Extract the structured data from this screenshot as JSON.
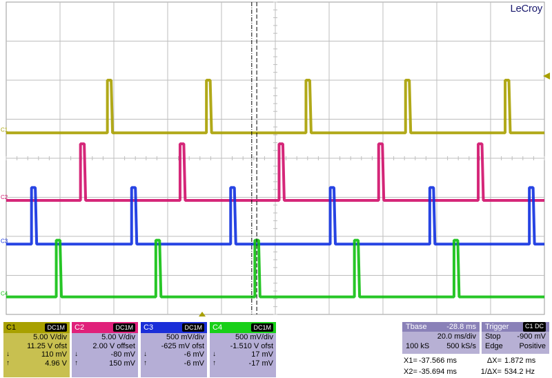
{
  "brand": "LeCroy",
  "chart_data": {
    "type": "line",
    "title": "",
    "xlabel": "",
    "ylabel": "",
    "time_per_div_ms": 20.0,
    "grid": true,
    "divisions": {
      "x": 10,
      "y": 8
    },
    "series": [
      {
        "name": "C1",
        "color": "#a8a000",
        "baseline_div": 3.35,
        "pulse_height_div": 1.35,
        "pulse_starts_div": [
          1.88,
          3.72,
          5.57,
          7.42,
          9.27
        ],
        "pulse_width_div": 0.07
      },
      {
        "name": "C2",
        "color": "#d0106a",
        "baseline_div": 5.08,
        "pulse_height_div": 1.45,
        "pulse_starts_div": [
          1.38,
          3.23,
          5.07,
          6.92,
          8.77
        ],
        "pulse_width_div": 0.07
      },
      {
        "name": "C3",
        "color": "#1030e0",
        "baseline_div": 6.2,
        "pulse_height_div": 1.45,
        "pulse_starts_div": [
          0.47,
          2.33,
          4.17,
          6.02,
          7.87,
          9.72
        ],
        "pulse_width_div": 0.07
      },
      {
        "name": "C4",
        "color": "#10c010",
        "baseline_div": 7.55,
        "pulse_height_div": 1.45,
        "pulse_starts_div": [
          0.93,
          2.78,
          4.62,
          6.47,
          8.32
        ],
        "pulse_width_div": 0.07
      }
    ],
    "cursors": {
      "x1_ms": -37.566,
      "x2_ms": -35.694
    }
  },
  "channels": [
    {
      "name": "C1",
      "coupling": "DC1M",
      "scale": "5.00 V/div",
      "offset": "11.25 V ofst",
      "down": "110 mV",
      "up": "4.96 V",
      "hdr_bg": "#a8a000",
      "body_bg": "#c8c050"
    },
    {
      "name": "C2",
      "coupling": "DC1M",
      "scale": "5.00 V/div",
      "offset": "2.00 V offset",
      "down": "-80 mV",
      "up": "150 mV",
      "hdr_bg": "#e0207a",
      "body_bg": "#b5aed6"
    },
    {
      "name": "C3",
      "coupling": "DC1M",
      "scale": "500 mV/div",
      "offset": "-625 mV ofst",
      "down": "-6 mV",
      "up": "-6 mV",
      "hdr_bg": "#1a2ed8",
      "body_bg": "#b5aed6"
    },
    {
      "name": "C4",
      "coupling": "DC1M",
      "scale": "500 mV/div",
      "offset": "-1.510 V ofst",
      "down": "17 mV",
      "up": "-17 mV",
      "hdr_bg": "#18d018",
      "body_bg": "#b5aed6"
    }
  ],
  "timebase": {
    "label": "Tbase",
    "offset": "-28.8 ms",
    "div": "20.0 ms/div",
    "samples": "100 kS",
    "rate": "500 kS/s"
  },
  "trigger": {
    "label": "Trigger",
    "badge": "C1 DC",
    "mode": "Stop",
    "level": "-900 mV",
    "type": "Edge",
    "slope": "Positive"
  },
  "cursor_readout": {
    "x1_label": "X1=",
    "x1": "-37.566 ms",
    "dx_label": "ΔX=",
    "dx": "1.872 ms",
    "x2_label": "X2=",
    "x2": "-35.694 ms",
    "inv_label": "1/ΔX=",
    "inv": "534.2 Hz"
  }
}
